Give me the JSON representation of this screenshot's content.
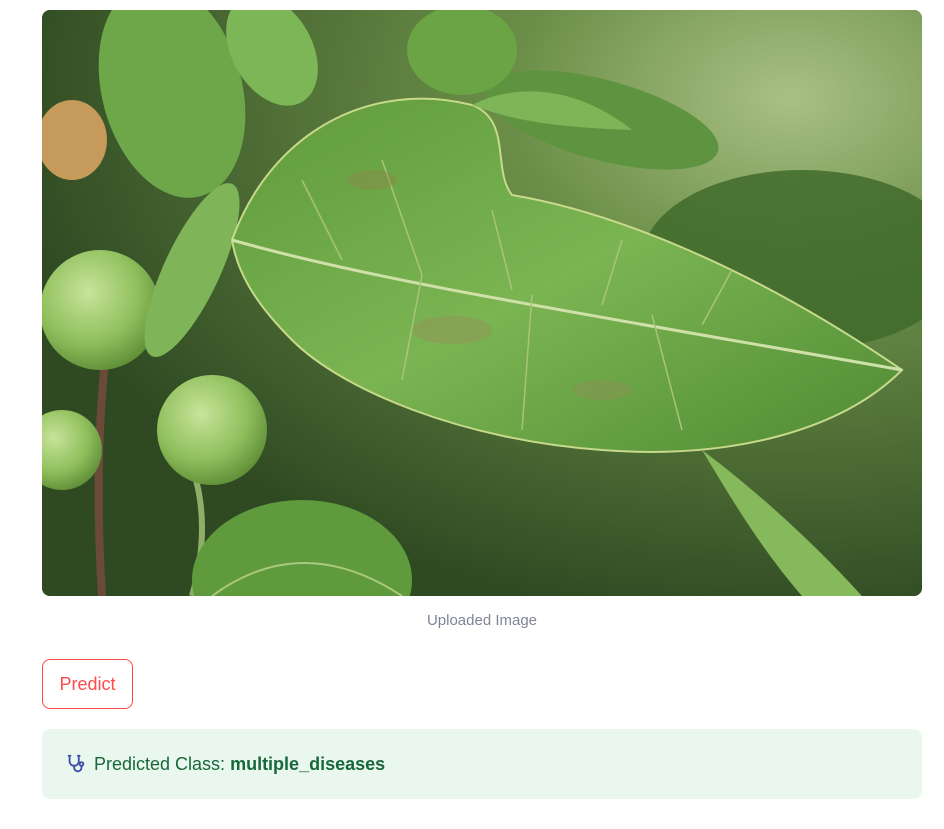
{
  "image": {
    "caption": "Uploaded Image",
    "alt": "apple leaf",
    "colors": {
      "background": "#3e5a2a",
      "leaf": "#6ea64a",
      "leaf_dark": "#4b7e32",
      "vein": "#cfe0a8",
      "apple": "#9ac76a"
    }
  },
  "actions": {
    "predict_label": "Predict"
  },
  "result": {
    "icon": "stethoscope-icon",
    "label": "Predicted Class: ",
    "value": "multiple_diseases"
  },
  "colors": {
    "accent": "#ff4b4b",
    "caption_text": "#808495",
    "success_bg": "#e9f7ee",
    "success_text": "#17683a"
  }
}
